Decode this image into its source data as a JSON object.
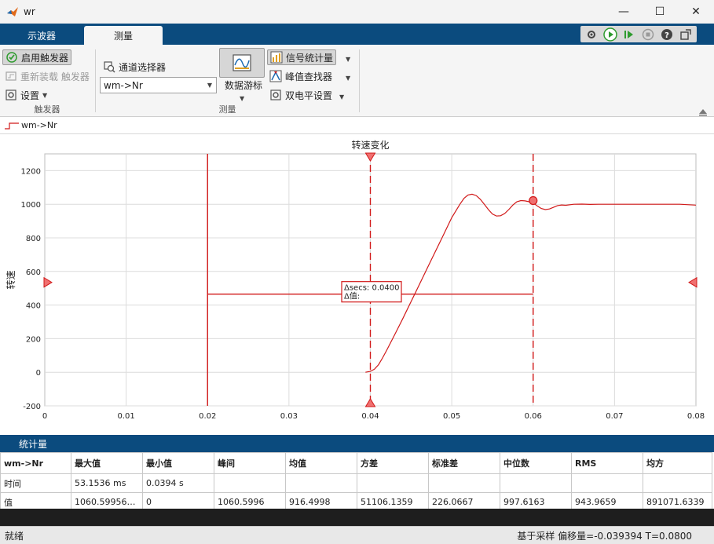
{
  "window": {
    "title": "wr"
  },
  "tabs": [
    {
      "label": "示波器",
      "active": false
    },
    {
      "label": "测量",
      "active": true
    }
  ],
  "ribbon": {
    "trigger": {
      "enable_label": "启用触发器",
      "rearm_label": "重新装载 触发器",
      "settings_label": "设置",
      "section_label": "触发器"
    },
    "measure": {
      "channel_selector_label": "通道选择器",
      "channel_value": "wm->Nr",
      "data_cursor_label": "数据游标",
      "signal_stats_label": "信号统计量",
      "peak_finder_label": "峰值查找器",
      "bilevel_label": "双电平设置",
      "section_label": "测量"
    }
  },
  "legend": {
    "series_name": "wm->Nr",
    "color": "#d11919"
  },
  "chart_data": {
    "type": "line",
    "title": "转速变化",
    "xlabel": "",
    "ylabel": "转速",
    "xlim": [
      0,
      0.08
    ],
    "ylim": [
      -200,
      1300
    ],
    "xticks": [
      "0",
      "0.01",
      "0.02",
      "0.03",
      "0.04",
      "0.05",
      "0.06",
      "0.07",
      "0.08"
    ],
    "yticks": [
      "-200",
      "0",
      "200",
      "400",
      "600",
      "800",
      "1000",
      "1200"
    ],
    "grid": true,
    "series": [
      {
        "name": "wm->Nr",
        "color": "#d11919",
        "x": [
          0.0394,
          0.04,
          0.0405,
          0.041,
          0.0415,
          0.042,
          0.043,
          0.044,
          0.045,
          0.046,
          0.047,
          0.048,
          0.049,
          0.05,
          0.051,
          0.0515,
          0.052,
          0.0525,
          0.053,
          0.0535,
          0.054,
          0.0545,
          0.055,
          0.0555,
          0.056,
          0.0565,
          0.057,
          0.0575,
          0.058,
          0.0585,
          0.059,
          0.0595,
          0.06,
          0.0605,
          0.061,
          0.0615,
          0.062,
          0.0625,
          0.063,
          0.0635,
          0.064,
          0.065,
          0.066,
          0.067,
          0.068,
          0.07,
          0.072,
          0.074,
          0.076,
          0.078,
          0.08
        ],
        "y": [
          0,
          5,
          18,
          45,
          85,
          130,
          225,
          320,
          420,
          520,
          620,
          720,
          820,
          920,
          1000,
          1035,
          1055,
          1060,
          1052,
          1030,
          1000,
          968,
          942,
          930,
          932,
          945,
          968,
          995,
          1015,
          1022,
          1020,
          1015,
          1008,
          990,
          975,
          968,
          972,
          982,
          992,
          996,
          994,
          1000,
          1001,
          999,
          1000,
          1000,
          1000,
          1000,
          1000,
          1000,
          995
        ]
      }
    ],
    "cursors": {
      "vertical_solid_x": [
        0.02
      ],
      "vertical_dashed_x": [
        0.04,
        0.06
      ],
      "horizontal_y": 465,
      "marker_point": {
        "x": 0.06,
        "y": 1022
      },
      "left_marker_y": 535,
      "right_marker_y": 535
    },
    "annotation": {
      "line1": "Δsecs: 0.0400",
      "line2": "Δ值:"
    }
  },
  "stats": {
    "title": "统计量",
    "headers": [
      "wm->Nr",
      "最大值",
      "最小值",
      "峰间",
      "均值",
      "方差",
      "标准差",
      "中位数",
      "RMS",
      "均方"
    ],
    "rows": [
      [
        "时间",
        "53.1536 ms",
        "0.0394 s",
        "",
        "",
        "",
        "",
        "",
        "",
        ""
      ],
      [
        "值",
        "1060.59956364…",
        "0",
        "1060.5996",
        "916.4998",
        "51106.1359",
        "226.0667",
        "997.6163",
        "943.9659",
        "891071.6339"
      ]
    ]
  },
  "status": {
    "left": "就绪",
    "right": "基于采样  偏移量=-0.039394  T=0.0800"
  },
  "colors": {
    "accent_blue": "#0b4b7e",
    "trace_red": "#d11919"
  }
}
